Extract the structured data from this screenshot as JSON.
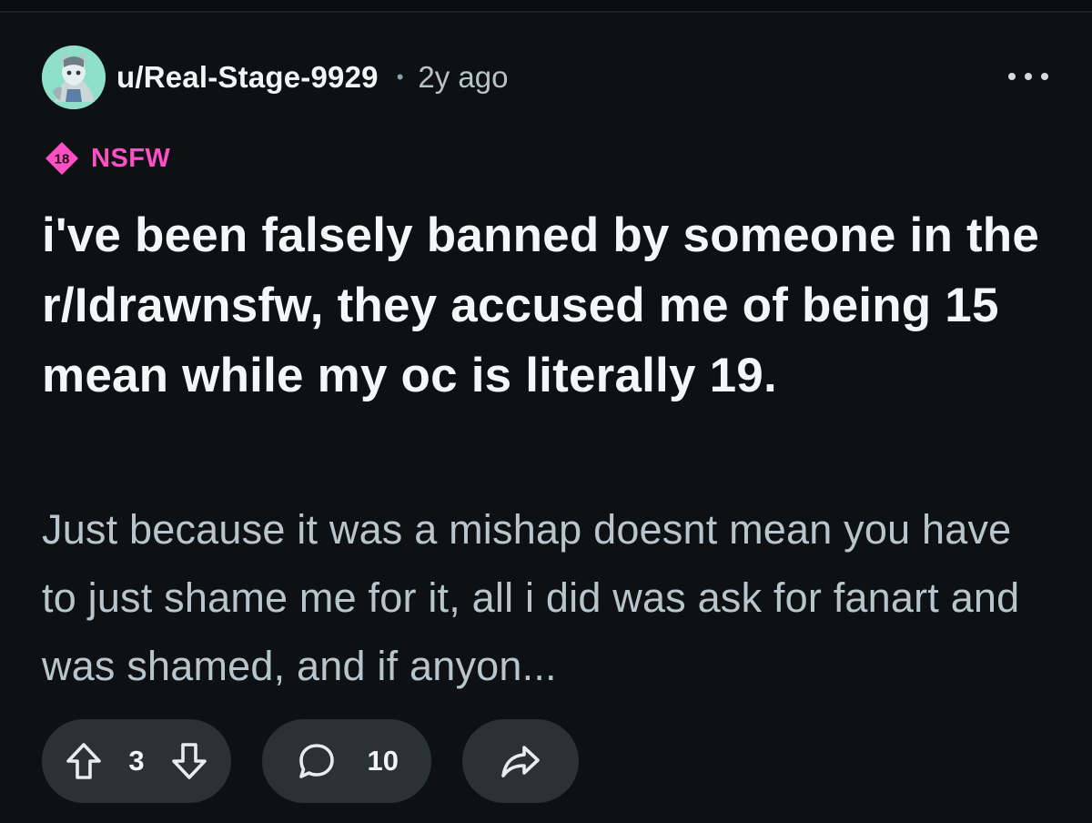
{
  "post": {
    "author": "u/Real-Stage-9929",
    "separator": "•",
    "age": "2y ago",
    "nsfw_badge": {
      "number": "18",
      "label": "NSFW",
      "color": "#ff4fc4"
    },
    "title": "i've been falsely banned by someone in the r/Idrawnsfw, they accused me of being 15 mean while my oc is literally 19.",
    "body_preview": "Just because it was a mishap doesnt mean you have to just shame me for it, all i did was ask for fanart and was shamed, and if anyon...",
    "vote_count": "3",
    "comment_count": "10"
  },
  "icons": {
    "avatar": "avatar-icon",
    "more": "more-options-icon",
    "nsfw": "nsfw-18-icon",
    "upvote": "upvote-arrow-icon",
    "downvote": "downvote-arrow-icon",
    "comment": "comment-bubble-icon",
    "share": "share-arrow-icon"
  },
  "colors": {
    "background": "#0e1113",
    "pill": "#2a3236",
    "title": "#f4f6f7",
    "body": "#b8c5cc",
    "accent_nsfw": "#ff4fc4"
  }
}
